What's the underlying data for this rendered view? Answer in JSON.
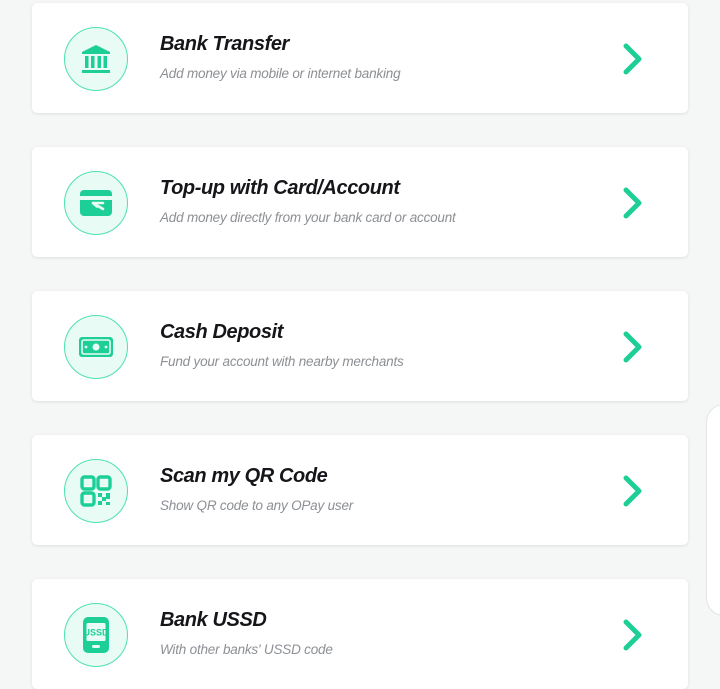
{
  "colors": {
    "accent": "#1dcf96",
    "icon_bg": "#e8fbf4",
    "icon_border": "#4ee0b3",
    "title": "#15151a",
    "subtitle": "#8c8f94"
  },
  "options": [
    {
      "icon": "bank-icon",
      "title": "Bank Transfer",
      "subtitle": "Add money via mobile or internet banking"
    },
    {
      "icon": "card-icon",
      "title": "Top-up with Card/Account",
      "subtitle": "Add money directly from your bank card or account"
    },
    {
      "icon": "cash-icon",
      "title": "Cash Deposit",
      "subtitle": "Fund your account with nearby merchants"
    },
    {
      "icon": "qr-code-icon",
      "title": "Scan my QR Code",
      "subtitle": "Show QR code to any OPay user"
    },
    {
      "icon": "ussd-phone-icon",
      "title": "Bank USSD",
      "subtitle": "With other banks' USSD code",
      "icon_text": "USSD"
    }
  ]
}
